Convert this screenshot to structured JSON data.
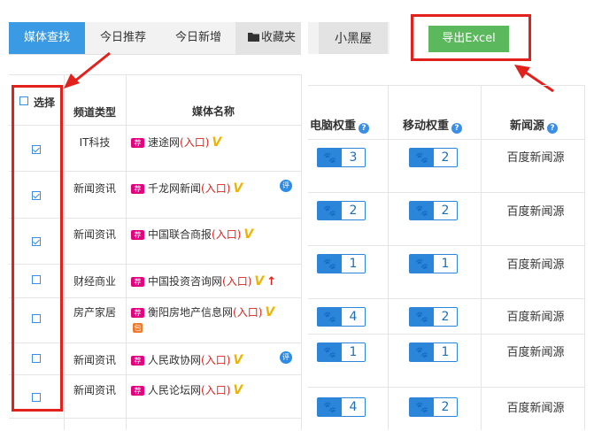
{
  "tabs": [
    {
      "label": "媒体查找",
      "active": true
    },
    {
      "label": "今日推荐",
      "active": false
    },
    {
      "label": "今日新增",
      "active": false
    },
    {
      "label": "收藏夹",
      "active": false
    }
  ],
  "tab_xiaoheiwu": "小黑屋",
  "export_label": "导出Excel",
  "left_headers": {
    "select": "选择",
    "channel": "频道类型",
    "media": "媒体名称"
  },
  "right_headers": {
    "pc_weight": "电脑权重",
    "mobile_weight": "移动权重",
    "news_source": "新闻源"
  },
  "help_glyph": "?",
  "tag_recommend": "荐",
  "tag_entry": "(入口)",
  "tag_v": "V",
  "tag_up": "↑",
  "tag_ping": "评",
  "tag_bao": "包",
  "rows": [
    {
      "checked": true,
      "channel": "IT科技",
      "name": "速途网",
      "pc": "3",
      "mobile": "2"
    },
    {
      "checked": true,
      "channel": "新闻资讯",
      "name": "千龙网新闻",
      "pc": "2",
      "mobile": "2"
    },
    {
      "checked": true,
      "channel": "新闻资讯",
      "name": "中国联合商报",
      "pc": "1",
      "mobile": "1"
    },
    {
      "checked": false,
      "channel": "财经商业",
      "name": "中国投资咨询网",
      "pc": "4",
      "mobile": "2"
    },
    {
      "checked": false,
      "channel": "房产家居",
      "name": "衡阳房地产信息网",
      "pc": "1",
      "mobile": "1"
    },
    {
      "checked": false,
      "channel": "新闻资讯",
      "name": "人民政协网",
      "pc": "4",
      "mobile": "2"
    },
    {
      "checked": false,
      "channel": "新闻资讯",
      "name": "人民论坛网"
    }
  ],
  "news_source_value": "百度新闻源",
  "colors": {
    "accent": "#3a9be4",
    "export": "#5cb85c",
    "highlight": "#e2211c",
    "recommend_tag": "#e4007f",
    "v_badge": "#f0b400",
    "weight_badge": "#2b86d9"
  }
}
